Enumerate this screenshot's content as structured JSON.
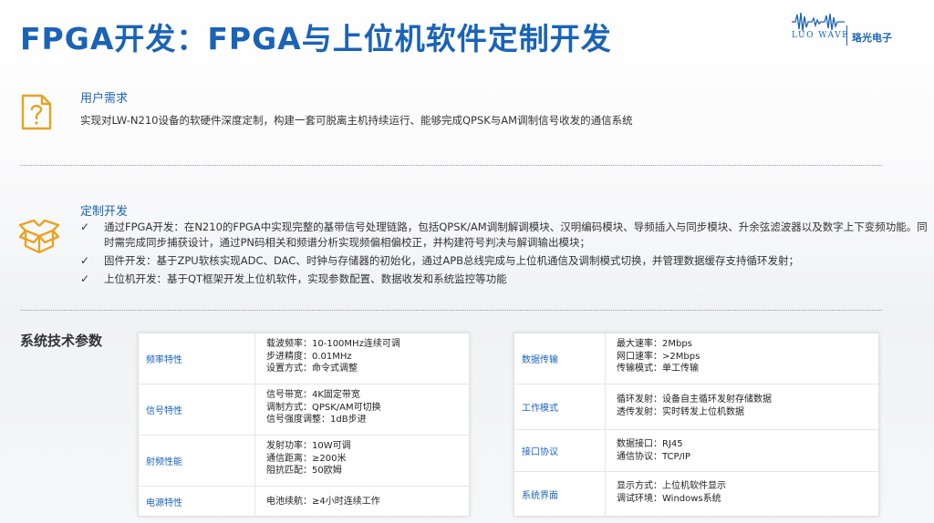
{
  "title": "FPGA开发：FPGA与上位机软件定制开发",
  "logo": {
    "en": "LUO WAVE",
    "cn": "珞光电子"
  },
  "requirement": {
    "heading": "用户需求",
    "text": "实现对LW-N210设备的软硬件深度定制，构建一套可脱离主机持续运行、能够完成QPSK与AM调制信号收发的通信系统"
  },
  "custom": {
    "heading": "定制开发",
    "bullets": [
      {
        "check": "✓",
        "text": "通过FPGA开发：在N210的FPGA中实现完整的基带信号处理链路，包括QPSK/AM调制解调模块、汉明编码模块、导频插入与同步模块、升余弦滤波器以及数字上下变频功能。同时需完成同步捕获设计，通过PN码相关和频谱分析实现频偏相偏校正，并构建符号判决与解调输出模块；"
      },
      {
        "check": "✓",
        "text": "固件开发：基于ZPU软核实现ADC、DAC、时钟与存储器的初始化，通过APB总线完成与上位机通信及调制模式切换，并管理数据缓存支持循环发射；"
      },
      {
        "check": "✓",
        "text": "上位机开发：基于QT框架开发上位机软件，实现参数配置、数据收发和系统监控等功能"
      }
    ]
  },
  "params": {
    "title": "系统技术参数",
    "left": [
      {
        "category": "频率特性",
        "values": [
          "载波频率：10-100MHz连续可调",
          "步进精度：0.01MHz",
          "设置方式：命令式调整"
        ]
      },
      {
        "category": "信号特性",
        "values": [
          "信号带宽：4K固定带宽",
          "调制方式：QPSK/AM可切换",
          "信号强度调整：1dB步进"
        ]
      },
      {
        "category": "射频性能",
        "values": [
          "发射功率：10W可调",
          "通信距离：≥200米",
          "阻抗匹配：50欧姆"
        ]
      },
      {
        "category": "电源特性",
        "values": [
          "电池续航：≥4小时连续工作"
        ]
      }
    ],
    "right": [
      {
        "category": "数据传输",
        "values": [
          "最大速率：2Mbps",
          "网口速率：>2Mbps",
          "传输模式：单工传输"
        ]
      },
      {
        "category": "工作模式",
        "values": [
          "循环发射：设备自主循环发射存储数据",
          "透传发射：实时转发上位机数据"
        ]
      },
      {
        "category": "接口协议",
        "values": [
          "数据接口：RJ45",
          "通信协议：TCP/IP"
        ]
      },
      {
        "category": "系统界面",
        "values": [
          "显示方式：上位机软件显示",
          "调试环境：Windows系统"
        ]
      }
    ]
  },
  "colors": {
    "accent": "#1a63b7",
    "icon": "#e8a21e"
  },
  "icons": {
    "requirement": "document-question-icon",
    "custom": "open-box-icon",
    "bullet": "check-icon"
  }
}
